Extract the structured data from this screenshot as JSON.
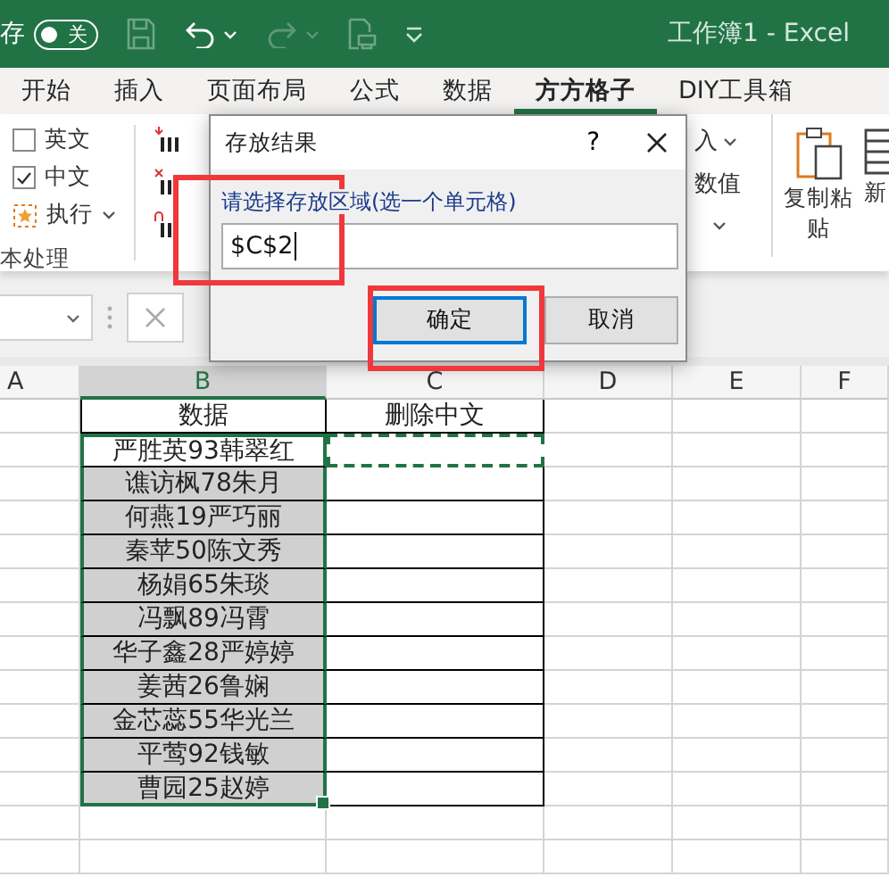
{
  "title_bar": {
    "autosave_label": "存",
    "autosave_toggle": {
      "label": "关",
      "on": false
    },
    "title": "工作簿1  -  Excel"
  },
  "ribbon_tabs": [
    {
      "label": "开始",
      "selected": false
    },
    {
      "label": "插入",
      "selected": false
    },
    {
      "label": "页面布局",
      "selected": false
    },
    {
      "label": "公式",
      "selected": false
    },
    {
      "label": "数据",
      "selected": false
    },
    {
      "label": "方方格子",
      "selected": true
    },
    {
      "label": "DIY工具箱",
      "selected": false
    }
  ],
  "ribbon": {
    "checkboxes": [
      {
        "label": "英文",
        "checked": false
      },
      {
        "label": "中文",
        "checked": true
      }
    ],
    "run_button": "执行",
    "group_label": "本处理",
    "insert_fragment": "入",
    "number_button": "数值",
    "paste_button": "复制粘贴",
    "new_fragment": "新"
  },
  "sheet": {
    "columns": [
      {
        "label": "A",
        "selected": false
      },
      {
        "label": "B",
        "selected": true
      },
      {
        "label": "C",
        "selected": false
      },
      {
        "label": "D",
        "selected": false
      },
      {
        "label": "E",
        "selected": false
      },
      {
        "label": "F",
        "selected": false
      }
    ],
    "headers": [
      "数据",
      "删除中文"
    ],
    "rows": [
      {
        "data": "严胜英93韩翠红",
        "selected": true,
        "active": true,
        "marquee": true
      },
      {
        "data": "谯访枫78朱月",
        "selected": true,
        "active": false,
        "marquee": false
      },
      {
        "data": "何燕19严巧丽",
        "selected": true,
        "active": false,
        "marquee": false
      },
      {
        "data": "秦苹50陈文秀",
        "selected": true,
        "active": false,
        "marquee": false
      },
      {
        "data": "杨娟65朱琰",
        "selected": true,
        "active": false,
        "marquee": false
      },
      {
        "data": "冯飘89冯霄",
        "selected": true,
        "active": false,
        "marquee": false
      },
      {
        "data": "华子鑫28严婷婷",
        "selected": true,
        "active": false,
        "marquee": false
      },
      {
        "data": "姜茜26鲁娴",
        "selected": true,
        "active": false,
        "marquee": false
      },
      {
        "data": "金芯蕊55华光兰",
        "selected": true,
        "active": false,
        "marquee": false
      },
      {
        "data": "平莺92钱敏",
        "selected": true,
        "active": false,
        "marquee": false
      },
      {
        "data": "曹园25赵婷",
        "selected": true,
        "active": false,
        "marquee": false
      }
    ]
  },
  "dialog": {
    "title": "存放结果",
    "help": "?",
    "prompt": "请选择存放区域(选一个单元格)",
    "value": "$C$2",
    "buttons": [
      {
        "label": "确定",
        "default": true
      },
      {
        "label": "取消",
        "default": false
      }
    ]
  }
}
